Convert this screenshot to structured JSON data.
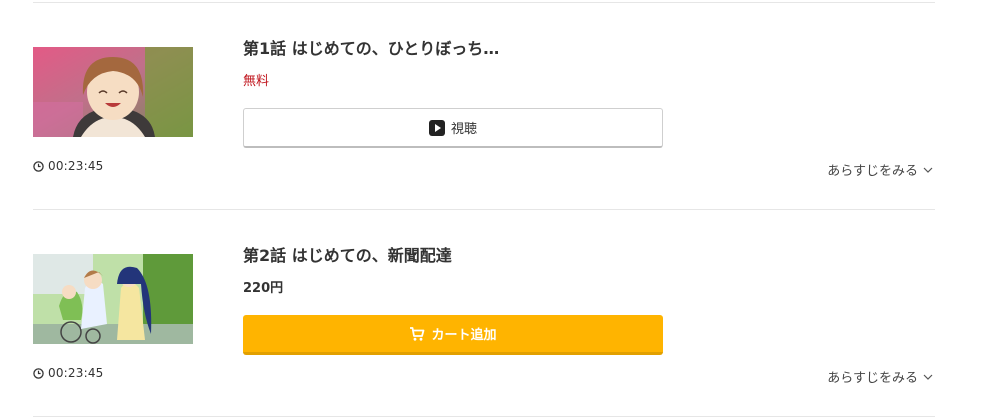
{
  "episodes": [
    {
      "title": "第1話 はじめての、ひとりぼっち…",
      "price": "無料",
      "button_label": "視聴",
      "button_icon": "play-icon",
      "duration": "00:23:45",
      "synopsis_link": "あらすじをみる"
    },
    {
      "title": "第2話 はじめての、新聞配達",
      "price": "220円",
      "button_label": "カート追加",
      "button_icon": "cart-icon",
      "duration": "00:23:45",
      "synopsis_link": "あらすじをみる"
    }
  ],
  "colors": {
    "free_price": "#c0141c",
    "cart_button": "#ffb400",
    "divider": "#e6e6e6"
  }
}
